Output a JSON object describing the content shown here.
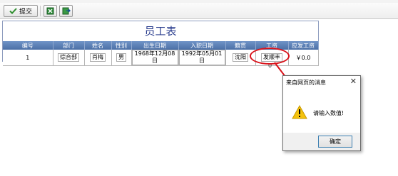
{
  "toolbar": {
    "submit_label": "提交",
    "icons": [
      "check-icon",
      "excel-export-icon",
      "export-icon"
    ]
  },
  "report": {
    "title": "员工表",
    "columns": [
      "编号",
      "部门",
      "姓名",
      "性别",
      "出生日期",
      "入职日期",
      "籍贯",
      "工资",
      "应发工资"
    ],
    "row": {
      "id": "1",
      "dept": "综合部",
      "name": "肖梅",
      "gender": "男",
      "birth": "1968年12月08日",
      "hire": "1992年05月01日",
      "native": "沈阳",
      "salary": "发顺丰",
      "net": "￥0.0"
    },
    "below_value": "0"
  },
  "annotation": {
    "color": "#d9131b"
  },
  "dialog": {
    "title": "来自网页的消息",
    "message": "请输入数值!",
    "ok_label": "确定",
    "close_glyph": "✕",
    "icon": "warning-icon"
  },
  "colors": {
    "header_blue": "#5a7db5",
    "title_blue": "#2c3f8f"
  }
}
